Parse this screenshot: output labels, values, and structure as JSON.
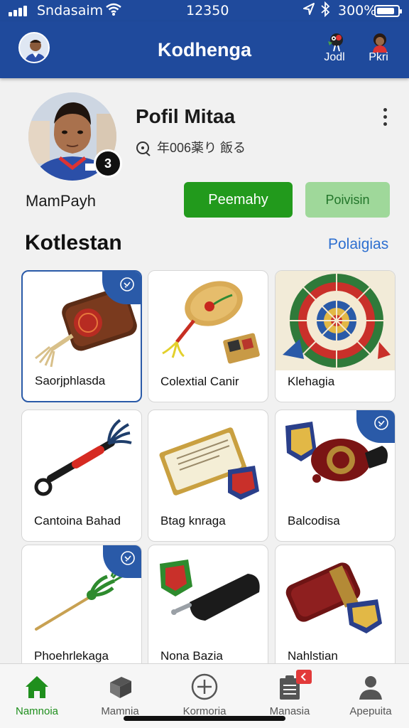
{
  "status_bar": {
    "carrier": "Sndasaim",
    "time": "12350",
    "battery_pct": "300%",
    "battery_level": 0.85,
    "icons": [
      "signal-icon",
      "wifi-icon",
      "location-icon",
      "bluetooth-icon",
      "battery-icon"
    ]
  },
  "header": {
    "title": "Kodhenga",
    "actions": [
      {
        "label": "Jodl",
        "icon": "bird-icon"
      },
      {
        "label": "Pkri",
        "icon": "user-avatar-icon"
      }
    ]
  },
  "profile": {
    "name": "Pofil Mitaa",
    "meta": "年006薬り 飯る",
    "meta_icon": "search-location-icon",
    "username": "MamPayh",
    "avatar_badge": "3",
    "primary_button": "Peemahy",
    "secondary_button": "Poivisin"
  },
  "collection": {
    "title": "Kotlestan",
    "link": "Polaigias",
    "items": [
      {
        "label": "Saorjphlasda",
        "icon": "leather-pouch-icon",
        "badge": true,
        "selected": true
      },
      {
        "label": "Colextial Canir",
        "icon": "wooden-fan-icon",
        "badge": false,
        "selected": false
      },
      {
        "label": "Klehagia",
        "icon": "prize-wheel-icon",
        "badge": false,
        "selected": false
      },
      {
        "label": "Cantoina Bahad",
        "icon": "tassel-whistle-icon",
        "badge": false,
        "selected": false
      },
      {
        "label": "Btag knraga",
        "icon": "gold-ticket-icon",
        "badge": false,
        "selected": false
      },
      {
        "label": "Balcodisa",
        "icon": "stamp-badge-icon",
        "badge": true,
        "selected": false
      },
      {
        "label": "Phoehrlekaga",
        "icon": "green-tassel-stick-icon",
        "badge": true,
        "selected": false
      },
      {
        "label": "Nona Bazia",
        "icon": "black-handle-icon",
        "badge": false,
        "selected": false
      },
      {
        "label": "Nahlstian",
        "icon": "red-case-icon",
        "badge": false,
        "selected": false
      }
    ]
  },
  "bottom_nav": [
    {
      "label": "Namnoia",
      "icon": "home-icon",
      "active": true
    },
    {
      "label": "Mamnia",
      "icon": "box-icon",
      "active": false
    },
    {
      "label": "Kormoria",
      "icon": "add-circle-icon",
      "active": false
    },
    {
      "label": "Manasia",
      "icon": "clipboard-icon",
      "active": false
    },
    {
      "label": "Apepuita",
      "icon": "person-icon",
      "active": false
    }
  ],
  "colors": {
    "brand_blue": "#1f4a9c",
    "primary_green": "#229a1c",
    "secondary_green": "#9fd89a",
    "link_blue": "#2d6fd0"
  }
}
